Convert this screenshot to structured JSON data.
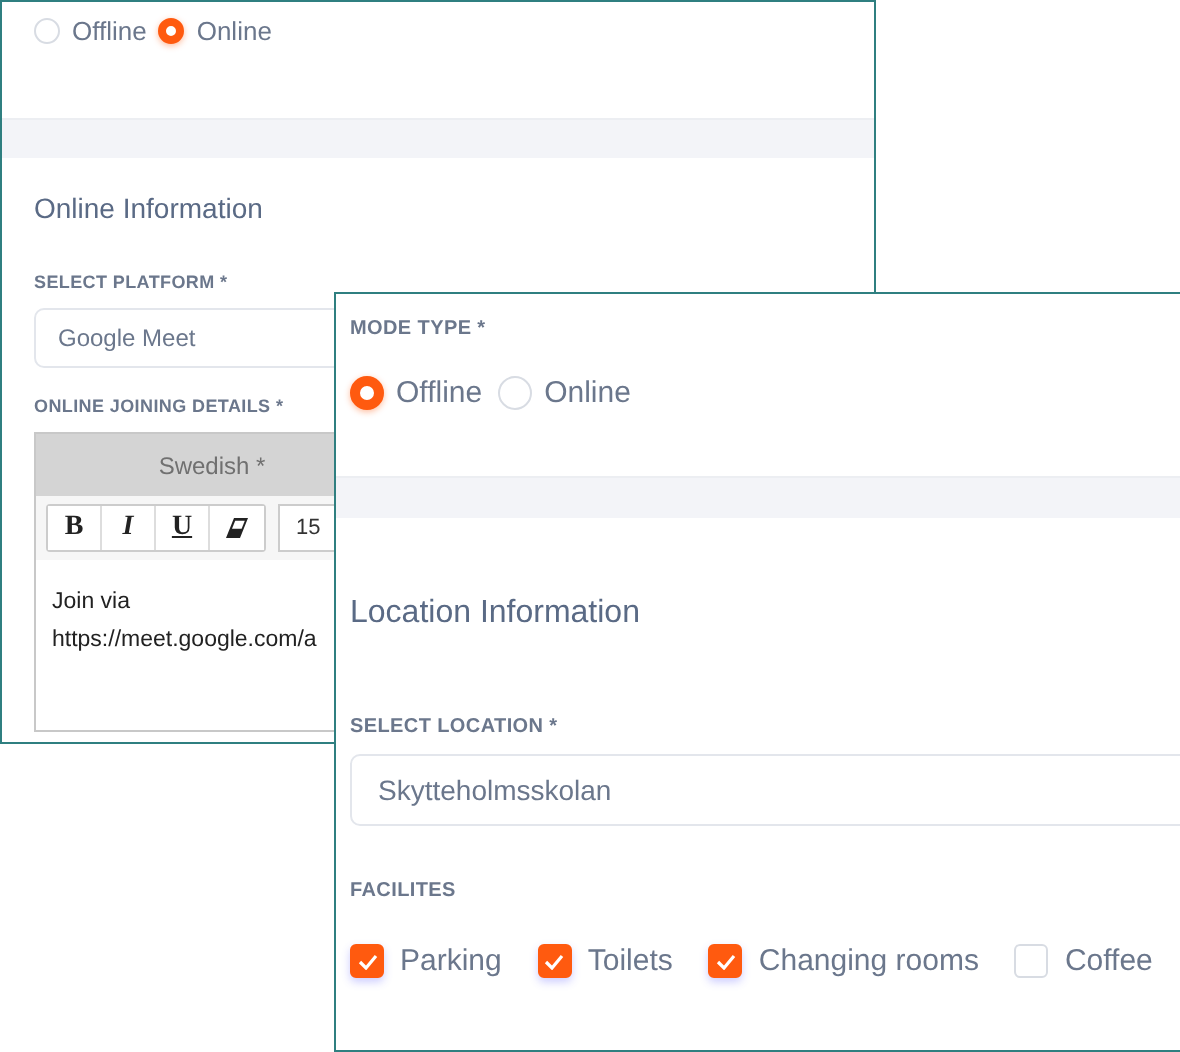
{
  "online_panel": {
    "mode_options": [
      {
        "label": "Offline",
        "selected": false
      },
      {
        "label": "Online",
        "selected": true
      }
    ],
    "section_title": "Online Information",
    "platform": {
      "label": "SELECT PLATFORM *",
      "value": "Google Meet"
    },
    "joining_details": {
      "label": "ONLINE JOINING DETAILS *",
      "language_tab": "Swedish *",
      "toolbar": [
        {
          "kind": "bold",
          "label": "B"
        },
        {
          "kind": "italic",
          "label": "I"
        },
        {
          "kind": "underline",
          "label": "U"
        },
        {
          "kind": "eraser"
        }
      ],
      "font_size": "15",
      "content": [
        "Join via",
        "https://meet.google.com/a"
      ]
    }
  },
  "location_panel": {
    "mode_label": "MODE TYPE *",
    "mode_options": [
      {
        "label": "Offline",
        "selected": true
      },
      {
        "label": "Online",
        "selected": false
      }
    ],
    "section_title": "Location Information",
    "location": {
      "label": "SELECT LOCATION *",
      "value": "Skytteholmsskolan"
    },
    "facilities": {
      "label": "FACILITES",
      "items": [
        {
          "label": "Parking",
          "checked": true
        },
        {
          "label": "Toilets",
          "checked": true
        },
        {
          "label": "Changing rooms",
          "checked": true
        },
        {
          "label": "Coffee",
          "checked": false
        }
      ]
    }
  }
}
